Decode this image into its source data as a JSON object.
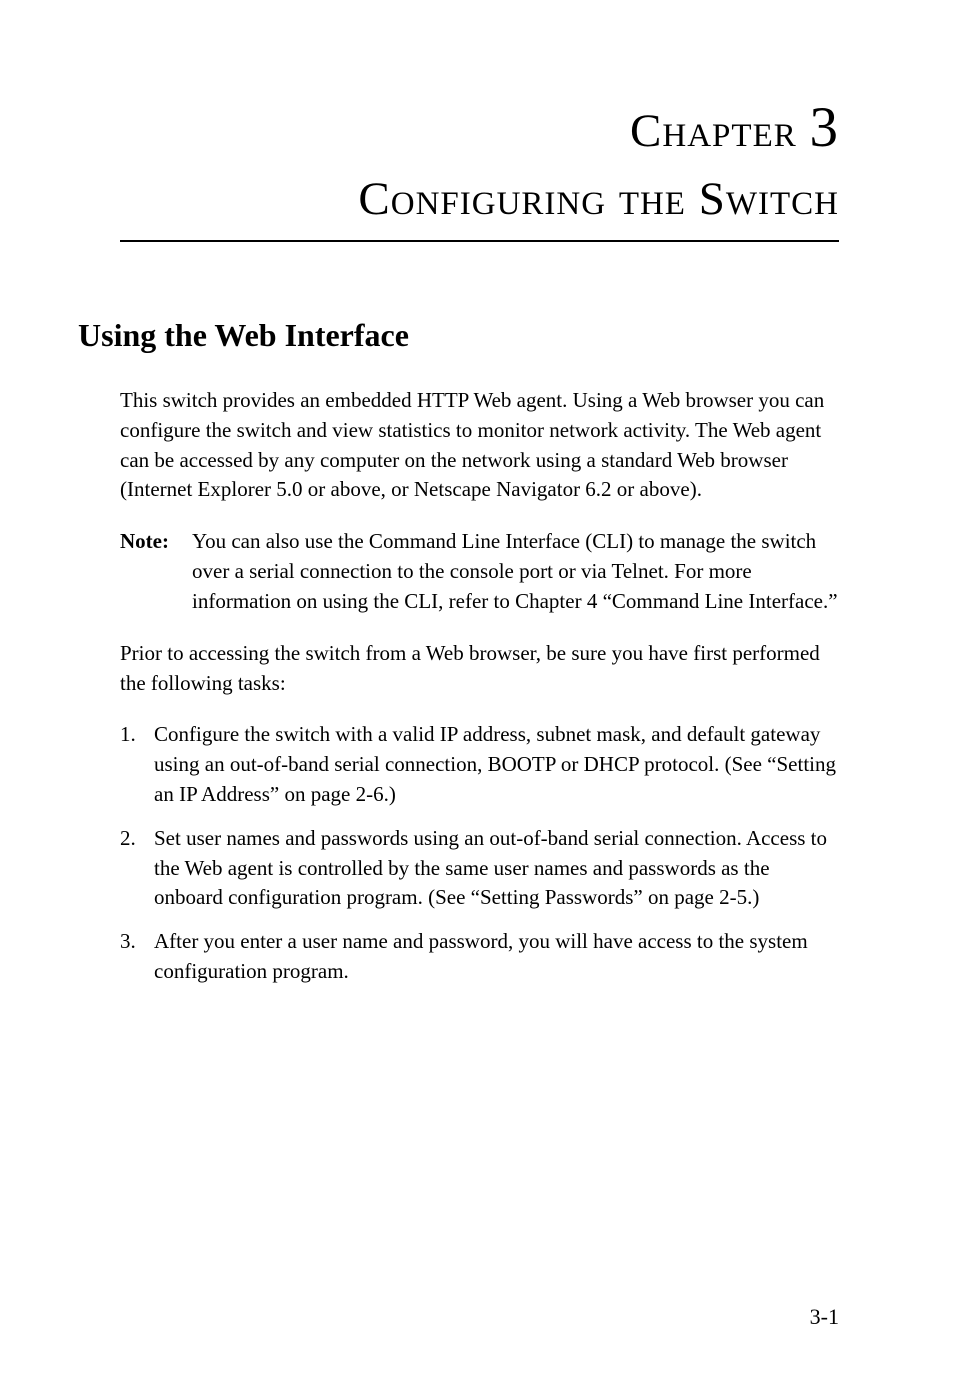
{
  "chapter": {
    "label": "Chapter",
    "number": "3",
    "title": "Configuring the Switch"
  },
  "section": {
    "heading": "Using the Web Interface",
    "intro": "This switch provides an embedded HTTP Web agent. Using a Web browser you can configure the switch and view statistics to monitor network activity. The Web agent can be accessed by any computer on the network using a standard Web browser (Internet Explorer 5.0 or above, or Netscape Navigator 6.2 or above).",
    "note": {
      "label": "Note:",
      "text": "You can also use the Command Line Interface (CLI) to manage the switch over a serial connection to the console port or via Telnet. For more information on using the CLI, refer to Chapter 4 “Command Line Interface.”"
    },
    "prior": "Prior to accessing the switch from a Web browser, be sure you have first performed the following tasks:",
    "steps": [
      "Configure the switch with a valid IP address, subnet mask, and default gateway using an out-of-band serial connection, BOOTP or DHCP protocol. (See “Setting an IP Address” on page 2-6.)",
      "Set user names and passwords using an out-of-band serial connection. Access to the Web agent is controlled by the same user names and passwords as the onboard configuration program. (See “Setting Passwords” on page 2-5.)",
      "After you enter a user name and password, you will have access to the system configuration program."
    ]
  },
  "page_number": "3-1"
}
